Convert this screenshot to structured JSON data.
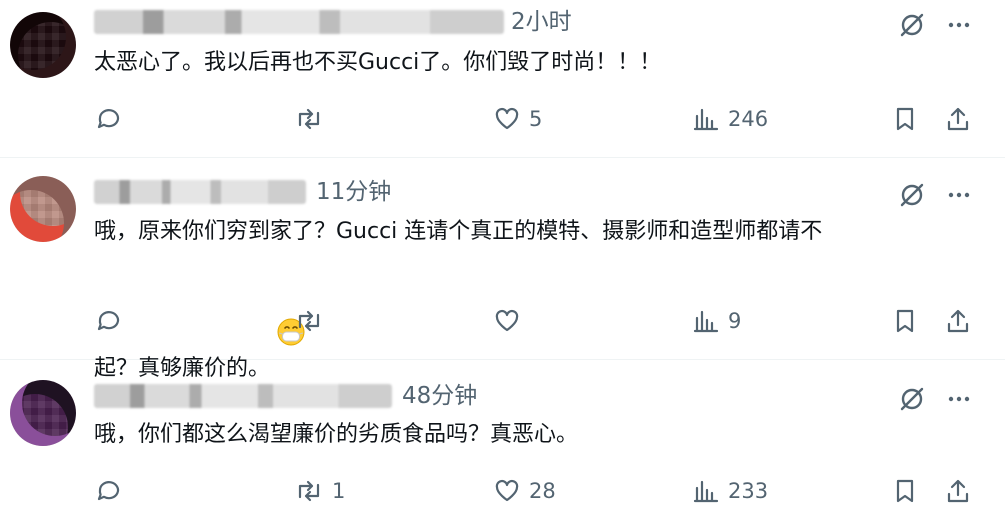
{
  "replies": [
    {
      "time": "2小时",
      "text": "太恶心了。我以后再也不买Gucci了。你们毁了时尚！！！",
      "reply_count": "",
      "repost_count": "",
      "like_count": "5",
      "view_count": "246",
      "avatar_colors": [
        "#1a0b0d",
        "#3b1f22"
      ]
    },
    {
      "time": "11分钟",
      "text": "哦，原来你们穷到家了？Gucci 连请个真正的模特、摄影师和造型师都请不\n起？真够廉价的。",
      "emoji": "mask-face-emoji",
      "reply_count": "",
      "repost_count": "",
      "like_count": "",
      "view_count": "9",
      "avatar_colors": [
        "#c98b7a",
        "#e24b3b"
      ]
    },
    {
      "time": "48分钟",
      "text": "哦，你们都这么渴望廉价的劣质食品吗？真恶心。",
      "reply_count": "",
      "repost_count": "1",
      "like_count": "28",
      "view_count": "233",
      "avatar_colors": [
        "#5e2a6b",
        "#2b1a2e"
      ]
    }
  ],
  "colors": {
    "icon_gray": "#536471",
    "text": "#0f1419",
    "divider": "#eff3f4"
  }
}
